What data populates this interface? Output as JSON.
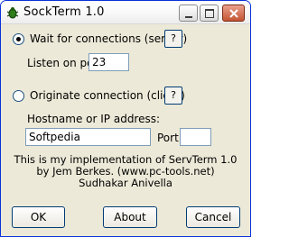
{
  "window": {
    "title": "SockTerm 1.0",
    "icon": "bug-icon"
  },
  "titlebar_buttons": {
    "minimize_icon": "minimize-icon",
    "maximize_icon": "maximize-icon",
    "close_icon": "close-icon"
  },
  "server": {
    "radio_label": "Wait for connections (server)",
    "checked": true,
    "help_label": "?",
    "port_label": "Listen on port",
    "port_value": "23"
  },
  "client": {
    "radio_label": "Originate connection (client)",
    "checked": false,
    "help_label": "?",
    "host_label": "Hostname or IP address:",
    "host_value": "Softpedia",
    "port_label": "Port:",
    "port_value": ""
  },
  "info": {
    "line1": "This is my implementation of ServTerm 1.0",
    "line2": "by Jem Berkes. (www.pc-tools.net)",
    "line3": "Sudhakar Anivella"
  },
  "buttons": {
    "ok": "OK",
    "about": "About",
    "cancel": "Cancel"
  },
  "colors": {
    "dialog_bg": "#ece9d8",
    "border_blue": "#003c74"
  }
}
